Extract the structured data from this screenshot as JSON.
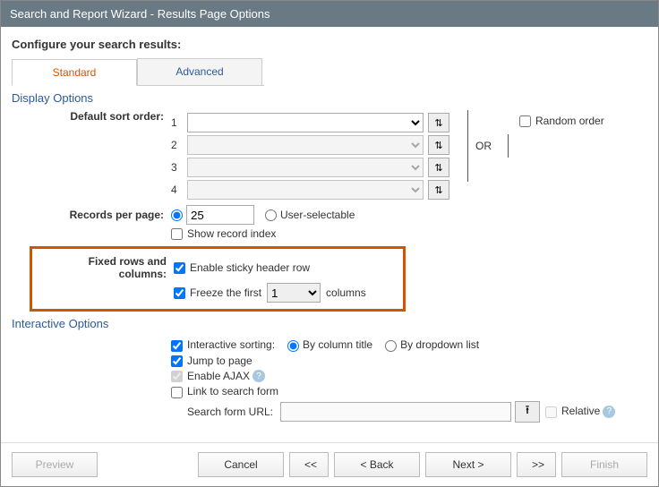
{
  "title": "Search and Report Wizard - Results Page Options",
  "heading": "Configure your search results:",
  "tabs": {
    "standard": "Standard",
    "advanced": "Advanced"
  },
  "display": {
    "sectionTitle": "Display Options",
    "defaultSortLabel": "Default sort order:",
    "nums": [
      "1",
      "2",
      "3",
      "4"
    ],
    "sortIcon": "⇅",
    "orText": "OR",
    "randomOrder": "Random order",
    "recordsPerPageLabel": "Records per page:",
    "recordsPerPageValue": "25",
    "userSelectable": "User-selectable",
    "showRecordIndex": "Show record index"
  },
  "fixed": {
    "label": "Fixed rows and columns:",
    "sticky": "Enable sticky header row",
    "freezePrefix": "Freeze the first",
    "freezeValue": "1",
    "freezeSuffix": "columns"
  },
  "interactive": {
    "sectionTitle": "Interactive Options",
    "sortingLabel": "Interactive sorting:",
    "byColumn": "By column title",
    "byDropdown": "By dropdown list",
    "jumpToPage": "Jump to page",
    "enableAjax": "Enable AJAX",
    "linkToSearch": "Link to search form",
    "searchFormUrlLabel": "Search form URL:",
    "relative": "Relative"
  },
  "footer": {
    "preview": "Preview",
    "cancel": "Cancel",
    "first": "<<",
    "back": "< Back",
    "next": "Next >",
    "last": ">>",
    "finish": "Finish"
  }
}
